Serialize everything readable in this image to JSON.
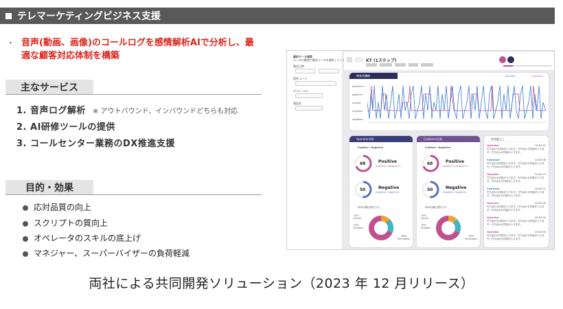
{
  "header": {
    "title": "テレマーケティングビジネス支援"
  },
  "lead": {
    "bullet": "・",
    "text": "音声(動画、画像)のコールログを感情解析AIで分析し、最適な顧客対応体制を構築"
  },
  "services": {
    "title": "主なサービス",
    "items": [
      {
        "num": "1.",
        "label": "音声ログ解析",
        "note": "※ アウトバウンド、インバウンドどちらも対応"
      },
      {
        "num": "2.",
        "label": "AI研修ツールの提供",
        "note": ""
      },
      {
        "num": "3.",
        "label": "コールセンター業務のDX推進支援",
        "note": ""
      }
    ]
  },
  "effects": {
    "title": "目的・効果",
    "items": [
      "応対品質の向上",
      "スクリプトの質向上",
      "オペレータのスキルの底上げ",
      "マネジャー、スーパーバイザーの負荷軽減"
    ]
  },
  "caption": "両社による共同開発ソリューション（2023 年 12 月リリース）",
  "dashboard": {
    "sidebar_title": "解析データ検索",
    "sidebar_sub": "データの範囲で解析データを選択してください",
    "filters": [
      "着信日時",
      "案件コード",
      "オペレーター",
      "電話先"
    ],
    "field_hints": [
      "開始日",
      "終了日",
      "案件名を選択してください",
      "山田 太郎",
      "全て"
    ],
    "call_title": "KT (1ステップ)",
    "timeline_label": "時系列遷移",
    "legend": [
      "Operator",
      "Customer"
    ],
    "y_labels": [
      "positive++",
      "positive+",
      "neutral",
      "negative",
      "negative--"
    ],
    "operator_panel": "Operator分析",
    "customer_panel": "Customer分析",
    "transcript_panel": "文字起こし",
    "pos_neg": "Positive / Negative",
    "op_positive_pct": "68",
    "op_negative_pct": "50",
    "cu_positive_pct": "68",
    "cu_negative_pct": "50",
    "positive_word": "Positive",
    "negative_word": "Negative",
    "positive_sub": "positive+ positive++",
    "negative_sub": "negative- negative--",
    "model_label": "KDD行動心理モデル",
    "op_model": {
      "a": "12%",
      "a_lbl": "Active",
      "b": "19%",
      "b_lbl": "Emotion",
      "c": "69%",
      "c_lbl": "Perception"
    },
    "cu_model": {
      "a": "12%",
      "a_lbl": "Active",
      "b": "19%",
      "b_lbl": "Emotion",
      "c": "69%",
      "c_lbl": "Perception"
    },
    "transcript": [
      {
        "speaker": "Operator",
        "time": "00:00:01"
      },
      {
        "speaker": "Customer",
        "time": "00:00:08"
      },
      {
        "speaker": "Operator",
        "time": "00:00:15"
      },
      {
        "speaker": "Customer",
        "time": "00:00:21"
      },
      {
        "speaker": "Operator",
        "time": "00:00:28"
      },
      {
        "speaker": "Operator",
        "time": "00:00:34"
      },
      {
        "speaker": "Operator",
        "time": "00:00:40"
      }
    ],
    "transcript_body": "行ち合わせ内容が入ります。行ち合わせ内容が入ります。行ち合わせ内容が入ります。",
    "colors": {
      "operator": "#3a7bd5",
      "customer": "#c0508f",
      "timeline_bar": "#2b2d5c",
      "op_bar": "#3b3d77",
      "cu_bar": "#6c5590"
    }
  }
}
